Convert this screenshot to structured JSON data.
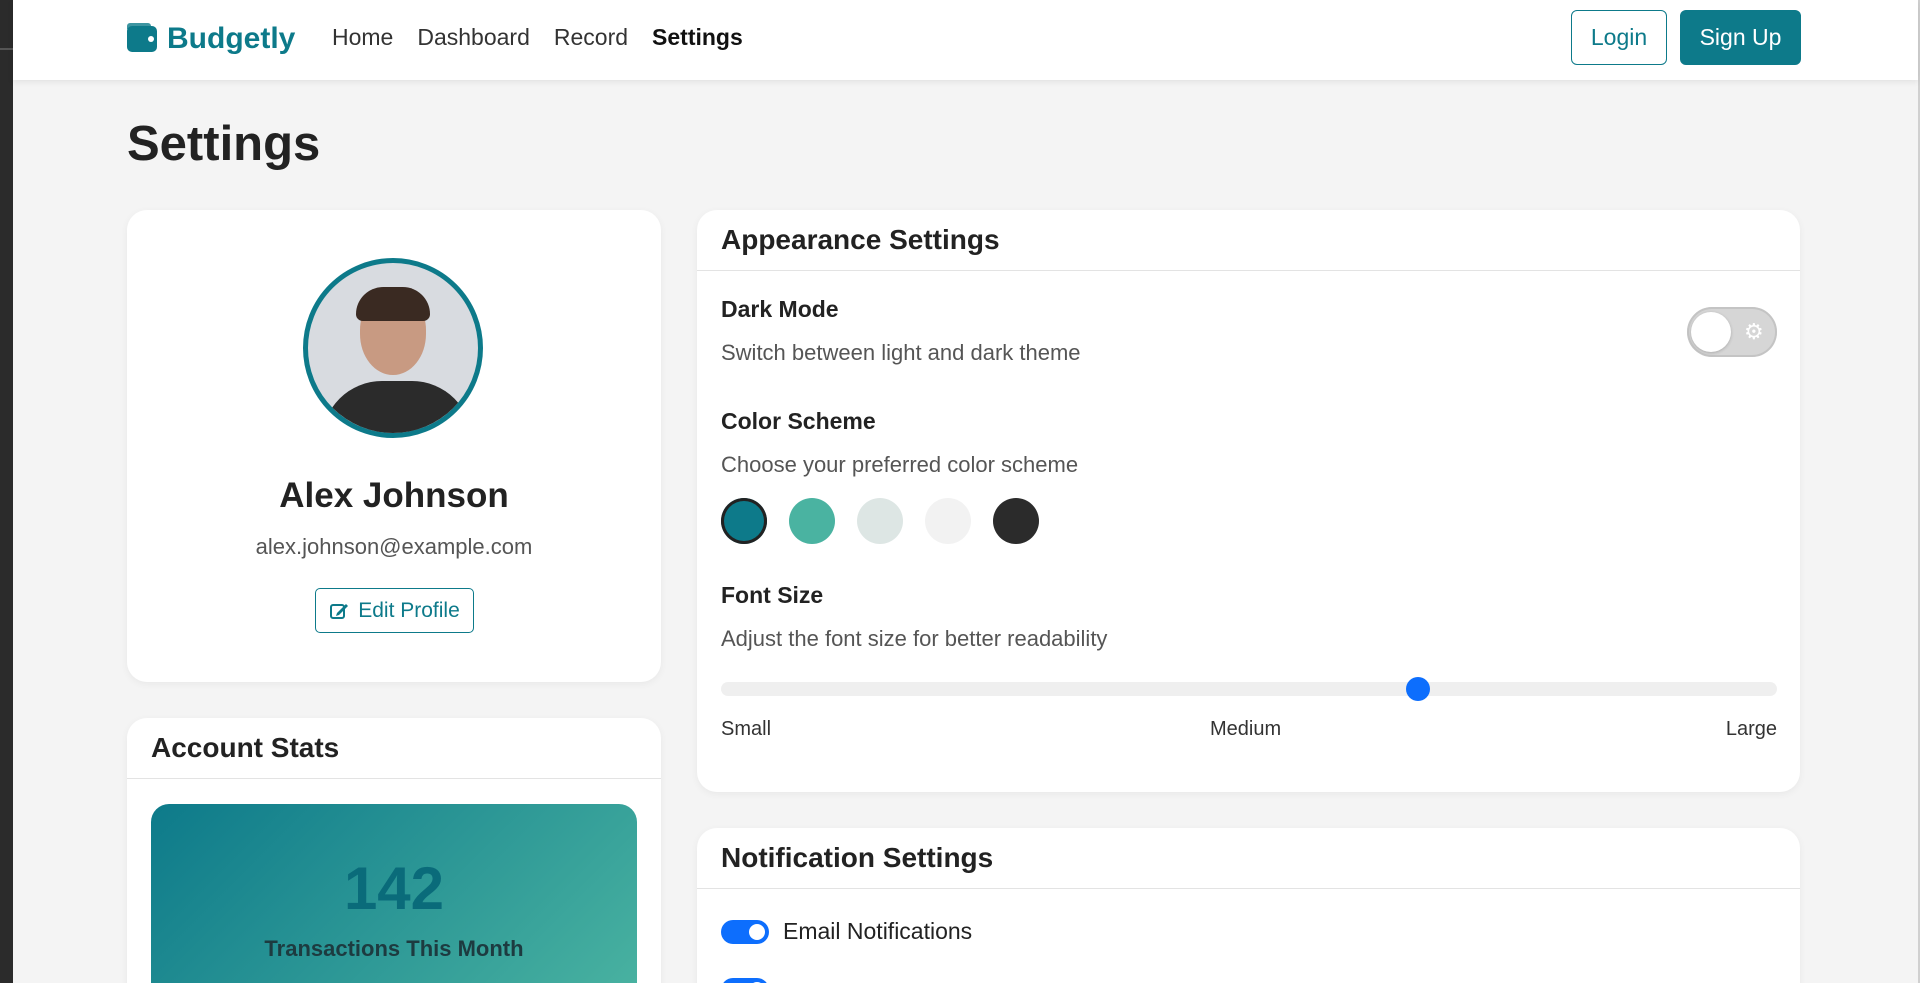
{
  "app": {
    "name": "Budgetly"
  },
  "nav": {
    "links": [
      {
        "label": "Home"
      },
      {
        "label": "Dashboard"
      },
      {
        "label": "Record"
      },
      {
        "label": "Settings"
      }
    ],
    "login_label": "Login",
    "signup_label": "Sign Up"
  },
  "page": {
    "title": "Settings"
  },
  "profile": {
    "name": "Alex Johnson",
    "email": "alex.johnson@example.com",
    "edit_label": "Edit Profile"
  },
  "stats": {
    "header": "Account Stats",
    "transactions_count": "142",
    "transactions_label": "Transactions This Month"
  },
  "appearance": {
    "header": "Appearance Settings",
    "dark_mode": {
      "title": "Dark Mode",
      "desc": "Switch between light and dark theme",
      "enabled": false
    },
    "color_scheme": {
      "title": "Color Scheme",
      "desc": "Choose your preferred color scheme",
      "swatches": [
        "#0d7a8a",
        "#4ab3a1",
        "#dde6e4",
        "#f2f2f2",
        "#2b2b2b"
      ],
      "selected_index": 0
    },
    "font_size": {
      "title": "Font Size",
      "desc": "Adjust the font size for better readability",
      "level": 0.66,
      "labels": {
        "small": "Small",
        "medium": "Medium",
        "large": "Large"
      }
    }
  },
  "notifications": {
    "header": "Notification Settings",
    "items": [
      {
        "label": "Email Notifications",
        "enabled": true
      }
    ]
  },
  "colors": {
    "accent": "#0d7a8a",
    "toggle_blue": "#0d6efd"
  }
}
